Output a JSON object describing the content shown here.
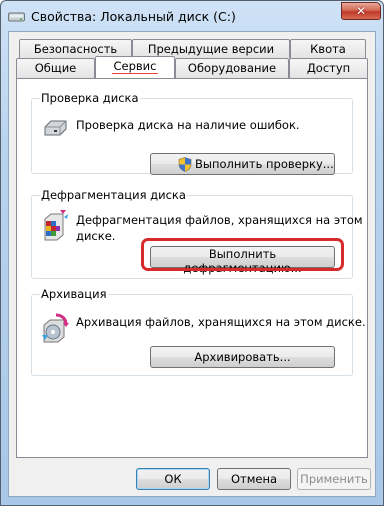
{
  "window": {
    "title": "Свойства: Локальный диск (C:)",
    "close_glyph": "✕"
  },
  "tabs_row1": [
    "Безопасность",
    "Предыдущие версии",
    "Квота"
  ],
  "tabs_row2": [
    "Общие",
    "Сервис",
    "Оборудование",
    "Доступ"
  ],
  "active_tab": "Сервис",
  "check": {
    "title": "Проверка диска",
    "description": "Проверка диска на наличие ошибок.",
    "button": "Выполнить проверку...",
    "icon": "hard-drive-icon",
    "button_icon": "uac-shield-icon"
  },
  "defrag": {
    "title": "Дефрагментация диска",
    "description_line1": "Дефрагментация файлов, хранящихся на этом",
    "description_line2": "диске.",
    "button": "Выполнить дефрагментацию...",
    "icon": "defragment-icon",
    "highlight_color": "#d72a2a"
  },
  "backup": {
    "title": "Архивация",
    "description": "Архивация файлов, хранящихся на этом диске.",
    "button": "Архивировать...",
    "icon": "backup-disk-icon"
  },
  "footer": {
    "ok": "ОК",
    "cancel": "Отмена",
    "apply": "Применить"
  }
}
